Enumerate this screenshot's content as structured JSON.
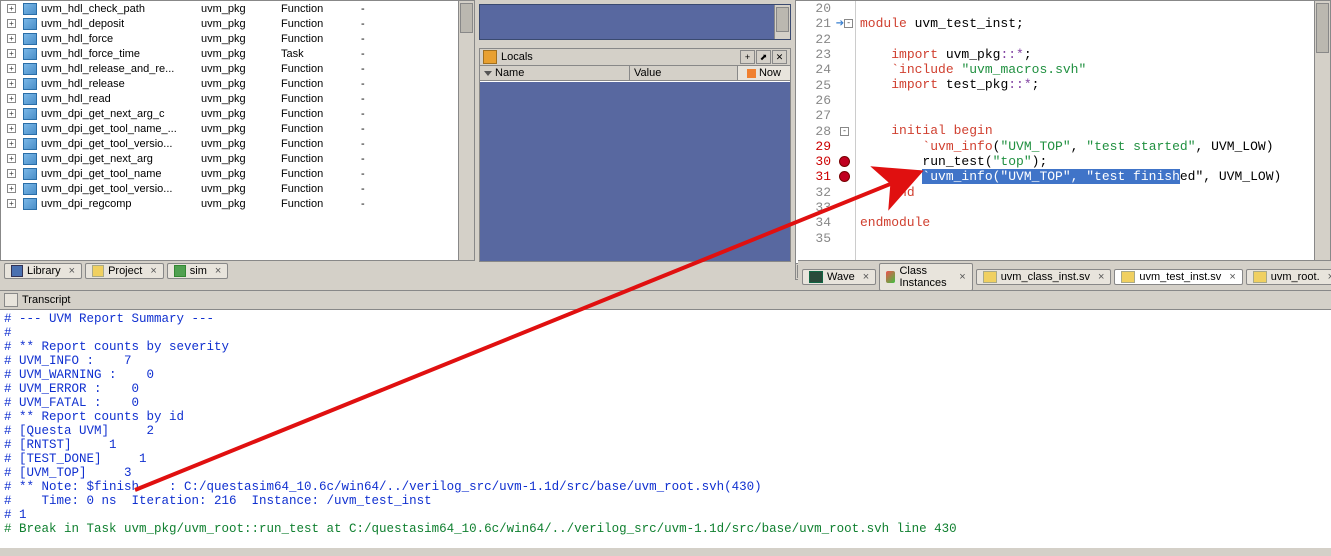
{
  "library": {
    "rows": [
      {
        "name": "uvm_hdl_check_path",
        "pkg": "uvm_pkg",
        "type": "Function",
        "extra": "-"
      },
      {
        "name": "uvm_hdl_deposit",
        "pkg": "uvm_pkg",
        "type": "Function",
        "extra": "-"
      },
      {
        "name": "uvm_hdl_force",
        "pkg": "uvm_pkg",
        "type": "Function",
        "extra": "-"
      },
      {
        "name": "uvm_hdl_force_time",
        "pkg": "uvm_pkg",
        "type": "Task",
        "extra": "-"
      },
      {
        "name": "uvm_hdl_release_and_re...",
        "pkg": "uvm_pkg",
        "type": "Function",
        "extra": "-"
      },
      {
        "name": "uvm_hdl_release",
        "pkg": "uvm_pkg",
        "type": "Function",
        "extra": "-"
      },
      {
        "name": "uvm_hdl_read",
        "pkg": "uvm_pkg",
        "type": "Function",
        "extra": "-"
      },
      {
        "name": "uvm_dpi_get_next_arg_c",
        "pkg": "uvm_pkg",
        "type": "Function",
        "extra": "-"
      },
      {
        "name": "uvm_dpi_get_tool_name_...",
        "pkg": "uvm_pkg",
        "type": "Function",
        "extra": "-"
      },
      {
        "name": "uvm_dpi_get_tool_versio...",
        "pkg": "uvm_pkg",
        "type": "Function",
        "extra": "-"
      },
      {
        "name": "uvm_dpi_get_next_arg",
        "pkg": "uvm_pkg",
        "type": "Function",
        "extra": "-"
      },
      {
        "name": "uvm_dpi_get_tool_name",
        "pkg": "uvm_pkg",
        "type": "Function",
        "extra": "-"
      },
      {
        "name": "uvm_dpi_get_tool_versio...",
        "pkg": "uvm_pkg",
        "type": "Function",
        "extra": "-"
      },
      {
        "name": "uvm_dpi_regcomp",
        "pkg": "uvm_pkg",
        "type": "Function",
        "extra": "-"
      }
    ],
    "tabs": [
      {
        "label": "Library",
        "icon": "library"
      },
      {
        "label": "Project",
        "icon": "project"
      },
      {
        "label": "sim",
        "icon": "sim"
      }
    ]
  },
  "locals": {
    "title": "Locals",
    "col1": "Name",
    "col2": "Value",
    "now": "Now"
  },
  "editor": {
    "lines": [
      {
        "n": 20
      },
      {
        "n": 21,
        "arrow": true,
        "fold": "-",
        "html": "<span class='kw'>module</span> uvm_test_inst;"
      },
      {
        "n": 22
      },
      {
        "n": 23,
        "html": "    <span class='kw'>import</span> uvm_pkg<span class='op'>::*</span>;"
      },
      {
        "n": 24,
        "html": "    <span class='kw'>`include</span> <span class='str'>\"uvm_macros.svh\"</span>"
      },
      {
        "n": 25,
        "html": "    <span class='kw'>import</span> test_pkg<span class='op'>::*</span>;"
      },
      {
        "n": 26
      },
      {
        "n": 27
      },
      {
        "n": 28,
        "fold": "-",
        "html": "    <span class='kw'>initial begin</span>"
      },
      {
        "n": 29,
        "red": true,
        "html": "        <span class='kw'>`uvm_info</span>(<span class='str'>\"UVM_TOP\"</span>, <span class='str'>\"test started\"</span>, UVM_LOW)"
      },
      {
        "n": 30,
        "red": true,
        "bp": true,
        "html": "        run_test(<span class='str'>\"top\"</span>);"
      },
      {
        "n": 31,
        "red": true,
        "bp": true,
        "html": "        <span class='sel'>`uvm_info(\"UVM_TOP\", \"test finish</span>ed\", UVM_LOW)"
      },
      {
        "n": 32,
        "html": "    <span class='kw'>end</span>"
      },
      {
        "n": 33
      },
      {
        "n": 34,
        "html": "<span class='kw'>endmodule</span>"
      },
      {
        "n": 35
      }
    ],
    "tabs": [
      {
        "label": "Wave",
        "icon": "wave"
      },
      {
        "label": "Class Instances",
        "icon": "cls"
      },
      {
        "label": "uvm_class_inst.sv",
        "icon": "sv"
      },
      {
        "label": "uvm_test_inst.sv",
        "icon": "sv",
        "active": true
      },
      {
        "label": "uvm_root.",
        "icon": "sv"
      }
    ]
  },
  "transcript": {
    "title": "Transcript",
    "lines": [
      {
        "cls": "tc-blue",
        "t": "# --- UVM Report Summary ---"
      },
      {
        "cls": "tc-blue",
        "t": "#"
      },
      {
        "cls": "tc-blue",
        "t": "# ** Report counts by severity"
      },
      {
        "cls": "tc-blue",
        "t": "# UVM_INFO :    7"
      },
      {
        "cls": "tc-blue",
        "t": "# UVM_WARNING :    0"
      },
      {
        "cls": "tc-blue",
        "t": "# UVM_ERROR :    0"
      },
      {
        "cls": "tc-blue",
        "t": "# UVM_FATAL :    0"
      },
      {
        "cls": "tc-blue",
        "t": "# ** Report counts by id"
      },
      {
        "cls": "tc-blue",
        "t": "# [Questa UVM]     2"
      },
      {
        "cls": "tc-blue",
        "t": "# [RNTST]     1"
      },
      {
        "cls": "tc-blue",
        "t": "# [TEST_DONE]     1"
      },
      {
        "cls": "tc-blue",
        "t": "# [UVM_TOP]     3"
      },
      {
        "cls": "tc-blue",
        "t": "# ** Note: $finish    : C:/questasim64_10.6c/win64/../verilog_src/uvm-1.1d/src/base/uvm_root.svh(430)"
      },
      {
        "cls": "tc-blue",
        "t": "#    Time: 0 ns  Iteration: 216  Instance: /uvm_test_inst"
      },
      {
        "cls": "tc-blue",
        "t": "# 1"
      },
      {
        "cls": "tc-green",
        "t": "# Break in Task uvm_pkg/uvm_root::run_test at C:/questasim64_10.6c/win64/../verilog_src/uvm-1.1d/src/base/uvm_root.svh line 430"
      }
    ]
  }
}
